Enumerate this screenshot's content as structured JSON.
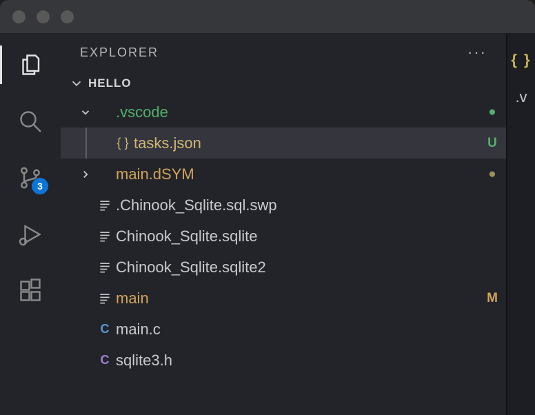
{
  "titlebar": {},
  "activitybar": {
    "scm_badge": "3"
  },
  "sidebar": {
    "title": "EXPLORER",
    "section": "HELLO"
  },
  "tree": [
    {
      "kind": "folder",
      "depth": 0,
      "expanded": true,
      "label": ".vscode",
      "labelClass": "c-green",
      "decor": "●",
      "decorClass": "dot-green",
      "icon": ""
    },
    {
      "kind": "file",
      "depth": 1,
      "selected": true,
      "label": "tasks.json",
      "labelClass": "c-khaki",
      "decor": "U",
      "decorClass": "c-green",
      "icon": "{ }",
      "iconClass": "c-khaki"
    },
    {
      "kind": "folder",
      "depth": 0,
      "expanded": false,
      "label": "main.dSYM",
      "labelClass": "c-amber",
      "decor": "●",
      "decorClass": "dot-khaki",
      "icon": ""
    },
    {
      "kind": "file",
      "depth": 0,
      "label": ".Chinook_Sqlite.sql.swp",
      "labelClass": "c-text",
      "decor": "",
      "icon": "lines"
    },
    {
      "kind": "file",
      "depth": 0,
      "label": "Chinook_Sqlite.sqlite",
      "labelClass": "c-text",
      "decor": "",
      "icon": "lines"
    },
    {
      "kind": "file",
      "depth": 0,
      "label": "Chinook_Sqlite.sqlite2",
      "labelClass": "c-text",
      "decor": "",
      "icon": "lines"
    },
    {
      "kind": "file",
      "depth": 0,
      "label": "main",
      "labelClass": "c-amber",
      "decor": "M",
      "decorClass": "c-amber",
      "icon": "lines"
    },
    {
      "kind": "file",
      "depth": 0,
      "label": "main.c",
      "labelClass": "c-text",
      "decor": "",
      "icon": "C",
      "iconClass": "c-blue"
    },
    {
      "kind": "file",
      "depth": 0,
      "label": "sqlite3.h",
      "labelClass": "c-text",
      "decor": "",
      "icon": "C",
      "iconClass": "c-purp"
    }
  ],
  "editor": {
    "tab_icon": "{ }",
    "filename_first": ".v"
  }
}
